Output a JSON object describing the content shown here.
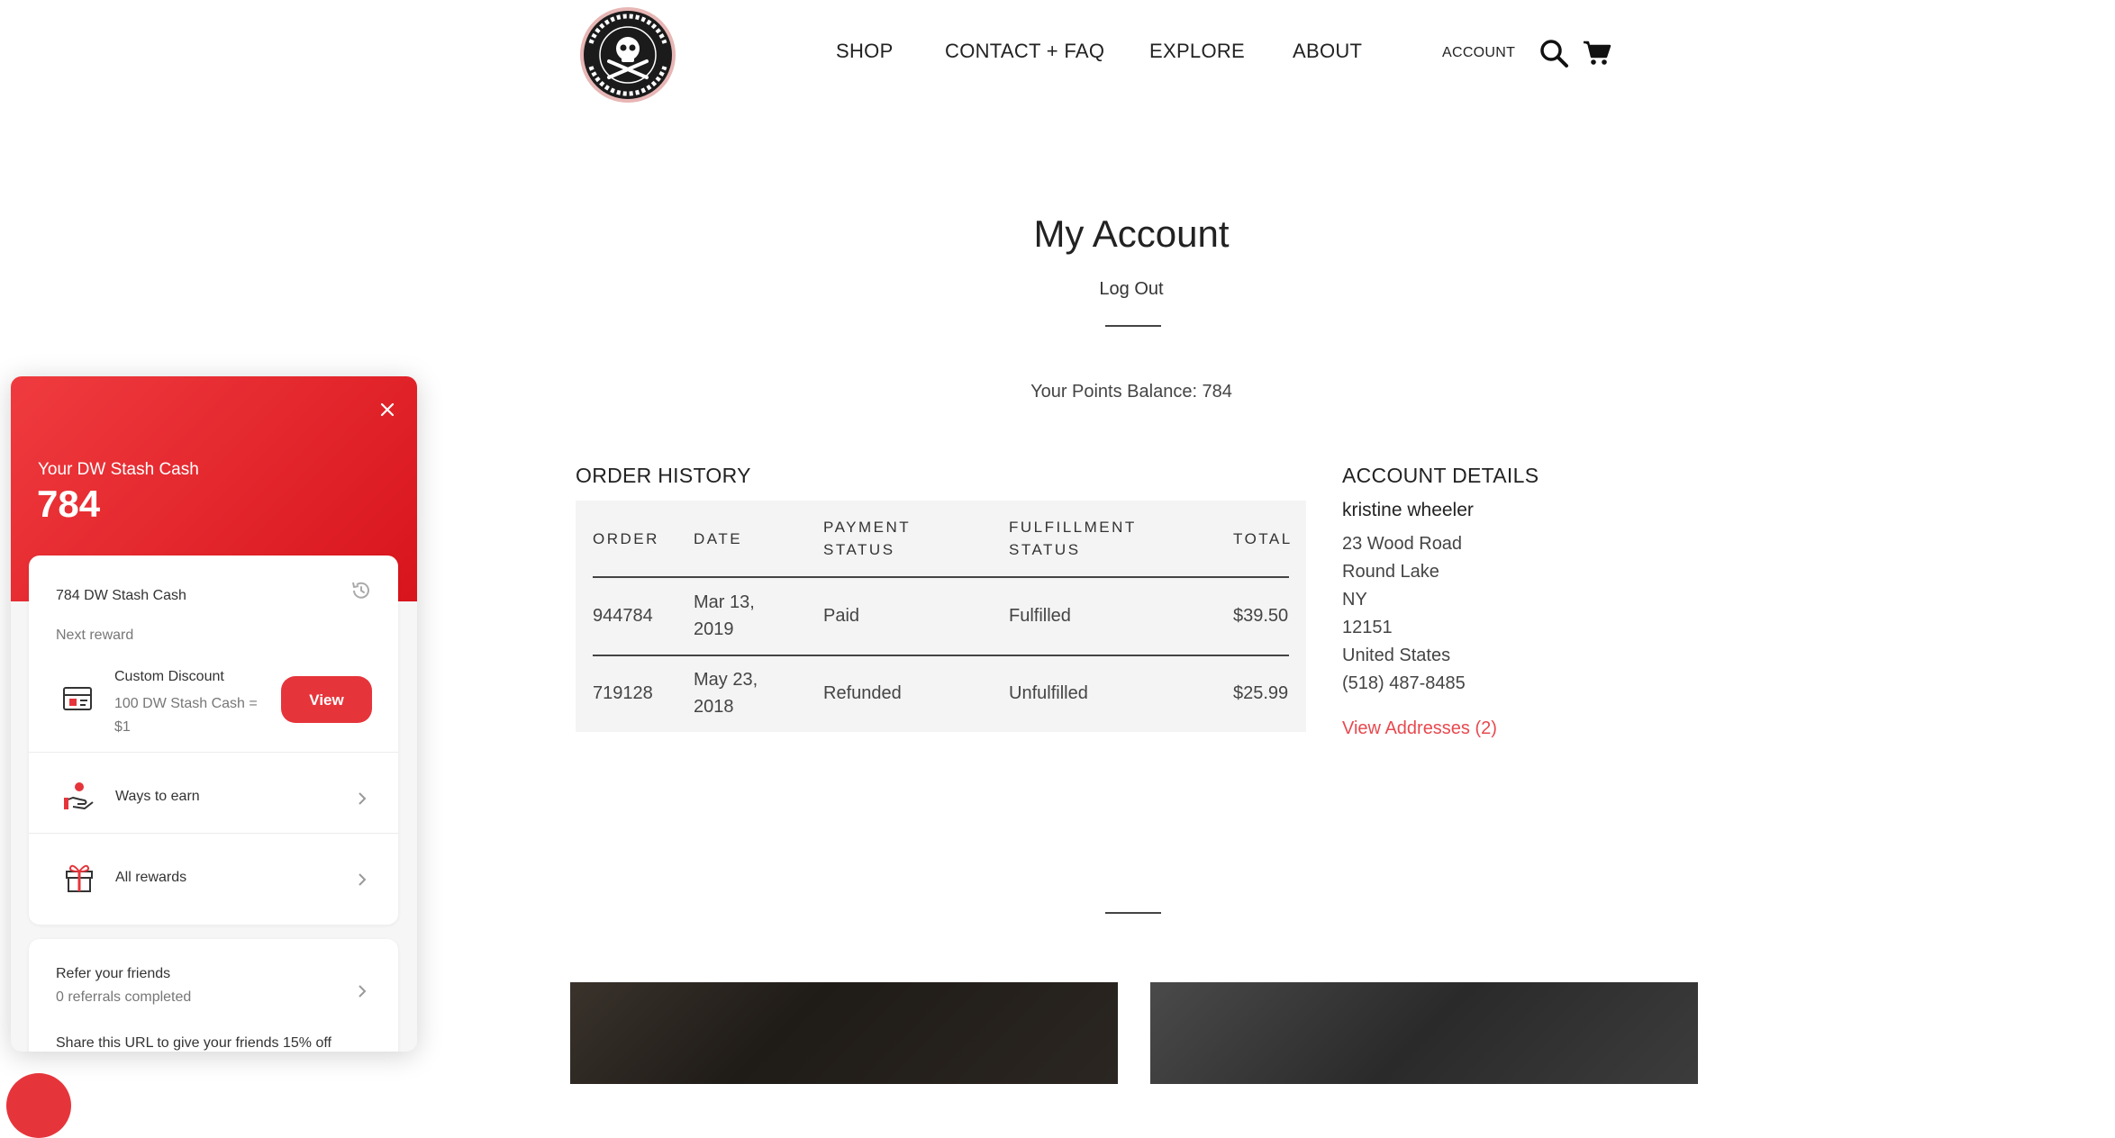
{
  "header": {
    "logo_alt": "DEATH WISH COFFEE CO.",
    "nav": [
      "SHOP",
      "CONTACT + FAQ",
      "EXPLORE",
      "ABOUT"
    ],
    "account_label": "ACCOUNT",
    "icons": [
      "search-icon",
      "cart-icon"
    ]
  },
  "main": {
    "title": "My Account",
    "logout_label": "Log Out",
    "points_text": "Your Points Balance: 784"
  },
  "orders": {
    "heading": "ORDER HISTORY",
    "columns": [
      "ORDER",
      "DATE",
      "PAYMENT STATUS",
      "FULFILLMENT STATUS",
      "TOTAL"
    ],
    "column_lines": [
      [
        "ORDER"
      ],
      [
        "DATE"
      ],
      [
        "PAYMENT",
        "STATUS"
      ],
      [
        "FULFILLMENT",
        "STATUS"
      ],
      [
        "TOTAL"
      ]
    ],
    "rows": [
      {
        "order": "944784",
        "date_lines": [
          "Mar 13,",
          "2019"
        ],
        "payment": "Paid",
        "fulfillment": "Fulfilled",
        "total": "$39.50"
      },
      {
        "order": "719128",
        "date_lines": [
          "May 23,",
          "2018"
        ],
        "payment": "Refunded",
        "fulfillment": "Unfulfilled",
        "total": "$25.99"
      }
    ]
  },
  "account_details": {
    "heading": "ACCOUNT DETAILS",
    "name": "kristine wheeler",
    "address_lines": [
      "23 Wood Road",
      "Round Lake",
      "NY",
      "12151",
      "United States",
      "(518) 487-8485"
    ],
    "view_addresses": "View Addresses (2)"
  },
  "rewards": {
    "label": "Your DW Stash Cash",
    "value": "784",
    "balance_text": "784 DW Stash Cash",
    "next_reward_label": "Next reward",
    "reward_name": "Custom Discount",
    "reward_desc_lines": [
      "100 DW Stash Cash =",
      "$1"
    ],
    "view_label": "View",
    "ways_to_earn": "Ways to earn",
    "all_rewards": "All rewards",
    "refer_title": "Refer your friends",
    "refer_count": "0 referrals completed",
    "share_text": "Share this URL to give your friends 15% off",
    "accent_color": "#e5353b",
    "icons": [
      "close-icon",
      "history-icon",
      "coupon-icon",
      "hand-coin-icon",
      "gift-icon",
      "chevron-right-icon"
    ]
  }
}
